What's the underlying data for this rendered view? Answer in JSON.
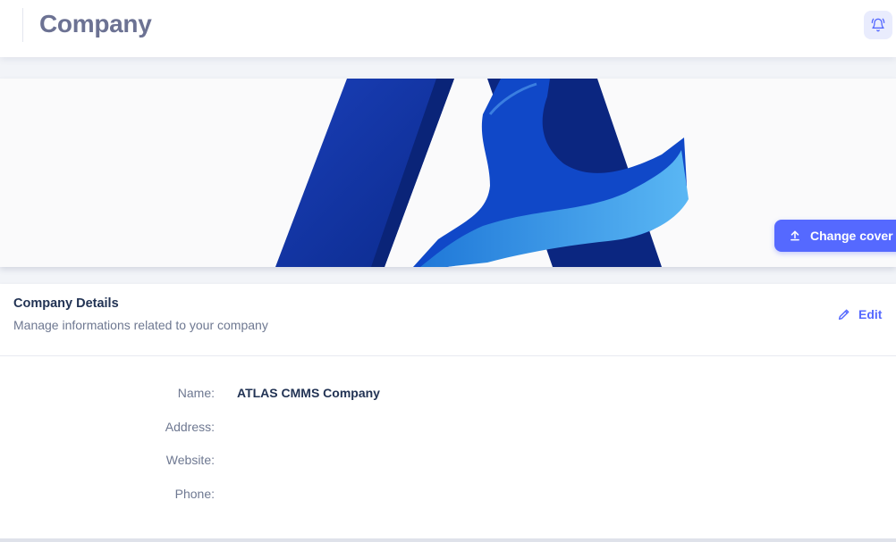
{
  "header": {
    "title": "Company",
    "notification_icon": "bell-ringing-icon"
  },
  "cover": {
    "change_cover_label": "Change cover",
    "upload_icon": "upload-icon"
  },
  "details": {
    "title": "Company Details",
    "subtitle": "Manage informations related to your company",
    "edit_label": "Edit",
    "edit_icon": "pencil-icon",
    "fields": [
      {
        "label": "Name:",
        "value": "ATLAS CMMS Company"
      },
      {
        "label": "Address:",
        "value": ""
      },
      {
        "label": "Website:",
        "value": ""
      },
      {
        "label": "Phone:",
        "value": ""
      }
    ]
  },
  "colors": {
    "accent": "#5569ff",
    "title": "#6c7293",
    "text_dark": "#223354",
    "text_muted": "#6e7891"
  }
}
